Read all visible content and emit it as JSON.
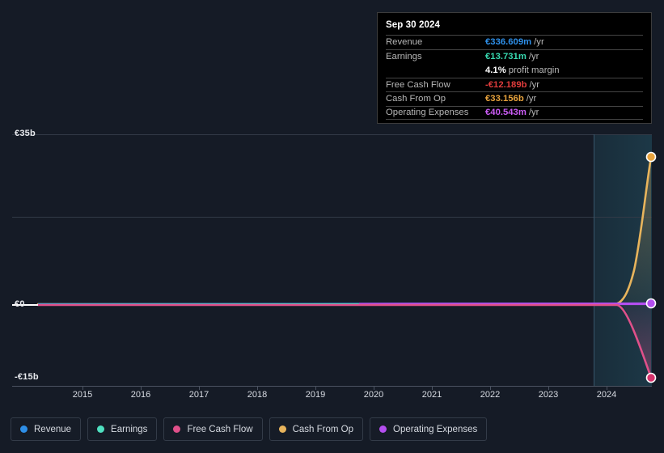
{
  "tooltip": {
    "date": "Sep 30 2024",
    "rows": [
      {
        "label": "Revenue",
        "value": "€336.609m",
        "suffix": "/yr",
        "color": "#2e8fe8"
      },
      {
        "label": "Earnings",
        "value": "€13.731m",
        "suffix": "/yr",
        "color": "#38d9b0"
      },
      {
        "label": "",
        "value": "4.1%",
        "suffix": "profit margin",
        "color": "#ffffff"
      },
      {
        "label": "Free Cash Flow",
        "value": "-€12.189b",
        "suffix": "/yr",
        "color": "#e03c3c"
      },
      {
        "label": "Cash From Op",
        "value": "€33.156b",
        "suffix": "/yr",
        "color": "#e8a33d"
      },
      {
        "label": "Operating Expenses",
        "value": "€40.543m",
        "suffix": "/yr",
        "color": "#cb5cf5"
      }
    ]
  },
  "legend": {
    "items": [
      {
        "label": "Revenue",
        "color": "#2e8fe8"
      },
      {
        "label": "Earnings",
        "color": "#4fe0c0"
      },
      {
        "label": "Free Cash Flow",
        "color": "#e0508a"
      },
      {
        "label": "Cash From Op",
        "color": "#e8b45c"
      },
      {
        "label": "Operating Expenses",
        "color": "#b44ef0"
      }
    ]
  },
  "chart_data": {
    "type": "line",
    "title": "",
    "xlabel": "",
    "ylabel": "",
    "grid": true,
    "legend_position": "bottom",
    "currency": "EUR",
    "ylim": [
      -15000000000,
      35000000000
    ],
    "ytick_labels": [
      "€35b",
      "€0",
      "-€15b"
    ],
    "ytick_values": [
      35000000000,
      0,
      -15000000000
    ],
    "xtick_labels": [
      "2015",
      "2016",
      "2017",
      "2018",
      "2019",
      "2020",
      "2021",
      "2022",
      "2023",
      "2024"
    ],
    "x": [
      2014.6,
      2015,
      2016,
      2017,
      2018,
      2019,
      2019.7,
      2020,
      2021,
      2022,
      2023,
      2023.6,
      2024,
      2024.75
    ],
    "series": [
      {
        "name": "Revenue",
        "color": "#2e8fe8",
        "values": [
          0,
          0,
          0,
          0,
          0,
          0,
          0,
          0,
          0,
          0,
          0,
          0,
          0,
          336609000
        ]
      },
      {
        "name": "Earnings",
        "color": "#4fe0c0",
        "values": [
          0,
          0,
          0,
          0,
          0,
          0,
          0,
          0,
          0,
          0,
          0,
          0,
          0,
          13731000
        ]
      },
      {
        "name": "Free Cash Flow",
        "color": "#e0508a",
        "values": [
          0,
          0,
          0,
          0,
          0,
          0,
          0,
          0,
          0,
          0,
          0,
          0,
          -1200000000,
          -12189000000
        ]
      },
      {
        "name": "Cash From Op",
        "color": "#e8b45c",
        "values": [
          0,
          0,
          0,
          0,
          0,
          0,
          0,
          0,
          0,
          0,
          0,
          0,
          3400000000,
          33156000000
        ]
      },
      {
        "name": "Operating Expenses",
        "color": "#b44ef0",
        "values": [
          null,
          null,
          null,
          null,
          null,
          null,
          0,
          0,
          0,
          0,
          0,
          0,
          0,
          40543000
        ]
      }
    ],
    "highlight_band": {
      "from": 2023.65,
      "to": 2024.75
    }
  }
}
